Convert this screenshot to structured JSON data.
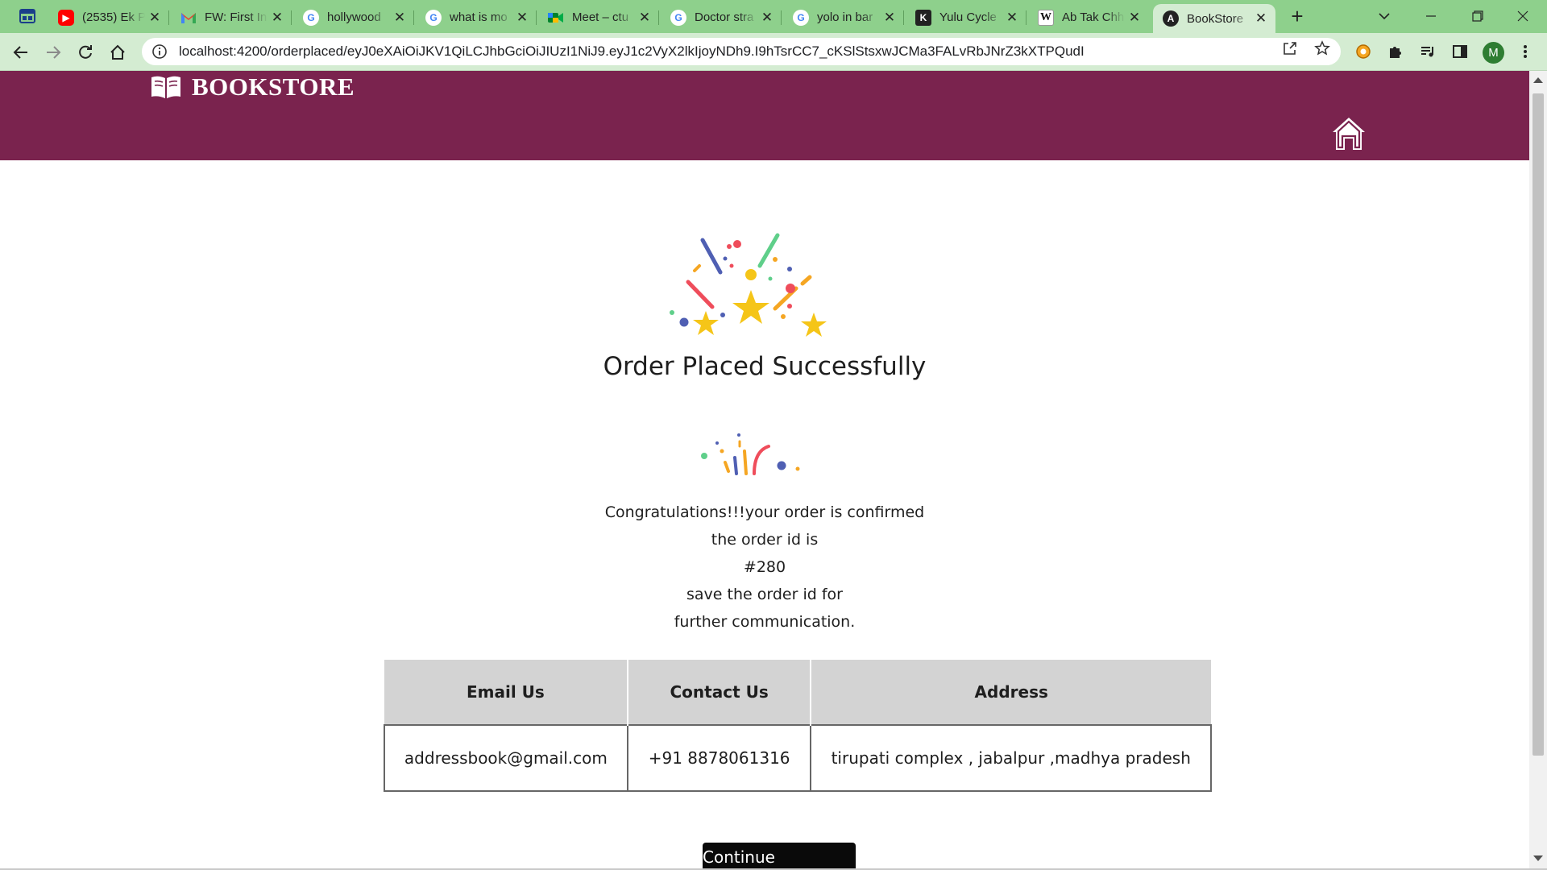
{
  "browser": {
    "tabs": [
      {
        "title": "(2535) Ek P",
        "icon": "youtube-icon",
        "color": "#ff0000"
      },
      {
        "title": "FW: First In",
        "icon": "gmail-icon",
        "color": "#ea4335"
      },
      {
        "title": "hollywood",
        "icon": "google-icon",
        "color": "#4285f4"
      },
      {
        "title": "what is mo",
        "icon": "google-icon",
        "color": "#4285f4"
      },
      {
        "title": "Meet – ctu",
        "icon": "meet-icon",
        "color": "#00832d"
      },
      {
        "title": "Doctor stra",
        "icon": "google-icon",
        "color": "#4285f4"
      },
      {
        "title": "yolo in bar",
        "icon": "google-icon",
        "color": "#4285f4"
      },
      {
        "title": "Yulu Cycle",
        "icon": "k-icon",
        "color": "#222222"
      },
      {
        "title": "Ab Tak Chh",
        "icon": "wikipedia-icon",
        "color": "#222222"
      },
      {
        "title": "BookStore",
        "icon": "angular-icon",
        "color": "#222222",
        "active": true
      }
    ],
    "url": "localhost:4200/orderplaced/eyJ0eXAiOiJKV1QiLCJhbGciOiJIUzI1NiJ9.eyJ1c2VyX2lkIjoyNDh9.I9hTsrCC7_cKSlStsxwJCMa3FALvRbJNrZ3kXTPQudI",
    "profile_initial": "M"
  },
  "header": {
    "brand": "BOOKSTORE"
  },
  "page": {
    "title": "Order Placed Successfully",
    "message_lines": [
      "Congratulations!!!your order is confirmed",
      "the order id is",
      "#280",
      "save the order id for",
      "further communication."
    ],
    "table": {
      "headers": [
        "Email Us",
        "Contact Us",
        "Address"
      ],
      "row": [
        "addressbook@gmail.com",
        "+91 8878061316",
        "tirupati complex , jabalpur ,madhya pradesh"
      ]
    },
    "continue_button": "Continue Shopping"
  },
  "colors": {
    "tabstrip": "#8ed08c",
    "toolbar": "#d4ecd2",
    "header": "#7a234e",
    "table_header": "#d3d3d3",
    "button": "#0a0a0a"
  }
}
